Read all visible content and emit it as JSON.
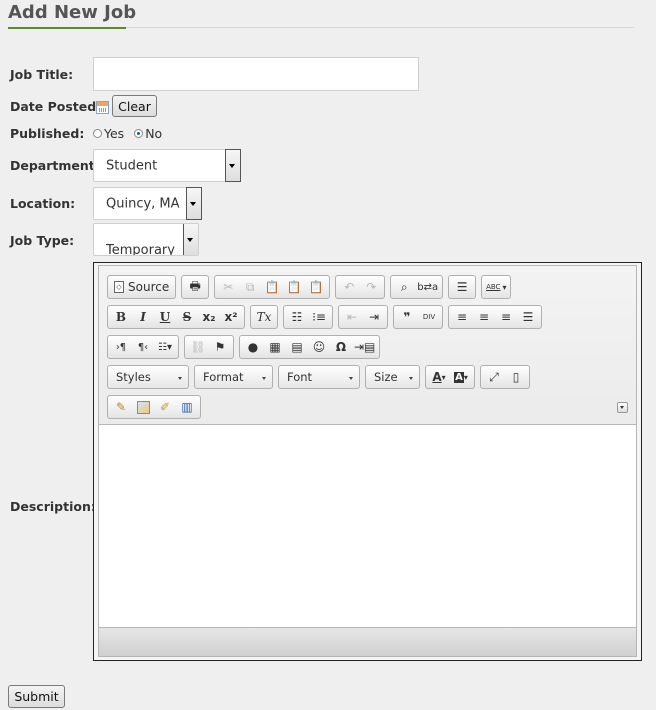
{
  "page": {
    "title": "Add New Job"
  },
  "form": {
    "job_title": {
      "label": "Job Title:",
      "value": ""
    },
    "date_posted": {
      "label": "Date Posted:",
      "clear_label": "Clear"
    },
    "published": {
      "label": "Published:",
      "options": [
        "Yes",
        "No"
      ],
      "selected": "No"
    },
    "department": {
      "label": "Department:",
      "value": "Student"
    },
    "location": {
      "label": "Location:",
      "value": "Quincy, MA"
    },
    "job_type": {
      "label": "Job Type:",
      "value": "Temporary"
    },
    "description": {
      "label": "Description:"
    },
    "submit_label": "Submit"
  },
  "editor": {
    "source_label": "Source",
    "combos": [
      "Styles",
      "Format",
      "Font",
      "Size"
    ],
    "icons": [
      "source-icon",
      "print-icon",
      "cut-icon",
      "copy-icon",
      "paste-icon",
      "paste-text-icon",
      "paste-word-icon",
      "undo-icon",
      "redo-icon",
      "find-icon",
      "replace-icon",
      "select-all-icon",
      "spellcheck-icon",
      "bold-icon",
      "italic-icon",
      "underline-icon",
      "strike-icon",
      "subscript-icon",
      "superscript-icon",
      "remove-format-icon",
      "numbered-list-icon",
      "bulleted-list-icon",
      "outdent-icon",
      "indent-icon",
      "blockquote-icon",
      "div-icon",
      "align-left-icon",
      "align-center-icon",
      "align-right-icon",
      "justify-icon",
      "ltr-icon",
      "rtl-icon",
      "language-icon",
      "unlink-icon",
      "anchor-icon",
      "flash-icon",
      "table-icon",
      "horizontal-rule-icon",
      "smiley-icon",
      "special-char-icon",
      "page-break-icon",
      "text-color-icon",
      "bg-color-icon",
      "maximize-icon",
      "show-blocks-icon",
      "image-edit-icon",
      "image-icon",
      "brush-icon",
      "book-icon",
      "collapse-icon"
    ],
    "glyphs": {
      "bold": "B",
      "italic": "I",
      "underline": "U",
      "strike": "S",
      "subscript": "x₂",
      "superscript": "x²",
      "remove_format": "Tx",
      "blockquote": "❞",
      "div": "DIV",
      "special_char": "Ω",
      "text_color": "A",
      "bg_color": "A",
      "find": "🔍",
      "abc": "ABC"
    }
  }
}
